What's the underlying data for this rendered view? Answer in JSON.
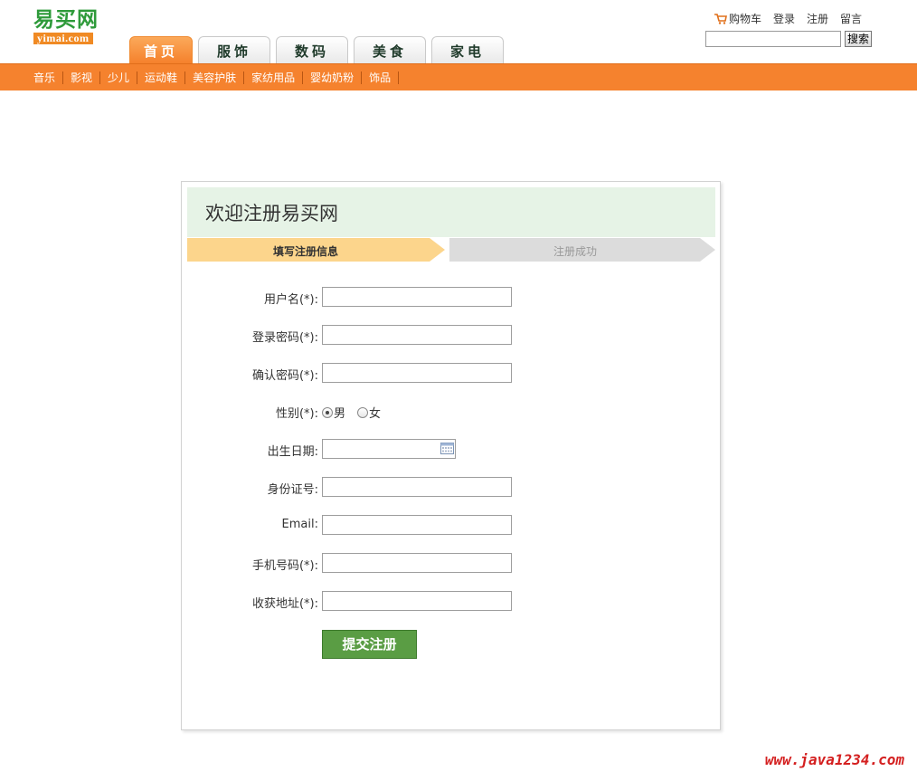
{
  "logo": {
    "name_cn": "易买网",
    "domain": "yimai.com"
  },
  "top_links": {
    "cart": "购物车",
    "login": "登录",
    "register": "注册",
    "message": "留言"
  },
  "search": {
    "value": "",
    "button": "搜索"
  },
  "main_nav": [
    {
      "label": "首页",
      "active": true
    },
    {
      "label": "服饰"
    },
    {
      "label": "数码"
    },
    {
      "label": "美食"
    },
    {
      "label": "家电"
    }
  ],
  "sub_nav": [
    "音乐",
    "影视",
    "少儿",
    "运动鞋",
    "美容护肤",
    "家纺用品",
    "婴幼奶粉",
    "饰品"
  ],
  "register": {
    "title": "欢迎注册易买网",
    "steps": [
      "填写注册信息",
      "注册成功"
    ],
    "fields": {
      "username": "用户名(*):",
      "password": "登录密码(*):",
      "confirm": "确认密码(*):",
      "gender": "性别(*):",
      "birthday": "出生日期:",
      "id_card": "身份证号:",
      "email": "Email:",
      "mobile": "手机号码(*):",
      "address": "收获地址(*):"
    },
    "gender_options": [
      "男",
      "女"
    ],
    "gender_selected": "男",
    "submit": "提交注册"
  },
  "watermark": "www.java1234.com",
  "colors": {
    "orange": "#f5822e",
    "green_button": "#5a9d44",
    "header_bg": "#e6f3e6",
    "step_active": "#fcd58c",
    "step_inactive": "#dcdcdc",
    "watermark": "#d42020"
  }
}
